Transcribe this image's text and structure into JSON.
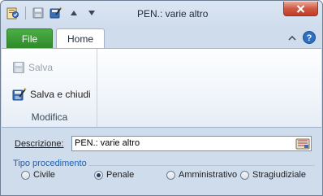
{
  "window": {
    "title": "PEN.: varie altro"
  },
  "quick_access": {
    "items": [
      "app-icon",
      "save-icon",
      "save-close-icon",
      "arrow-up-icon",
      "arrow-down-icon"
    ]
  },
  "tabs": {
    "file": "File",
    "home": "Home"
  },
  "ribbon": {
    "group": {
      "label": "Modifica",
      "save_label": "Salva",
      "save_close_label": "Salva e chiudi"
    }
  },
  "form": {
    "descrizione_label": "Descrizione:",
    "descrizione_value": "PEN.: varie altro",
    "tipo_procedimento": {
      "legend": "Tipo procedimento",
      "options": [
        "Civile",
        "Penale",
        "Amministrativo",
        "Stragiudiziale"
      ],
      "selected": "Penale"
    }
  },
  "colors": {
    "file_tab": "#3a9a34",
    "legend": "#1f5fae",
    "close_button": "#c94a36"
  }
}
